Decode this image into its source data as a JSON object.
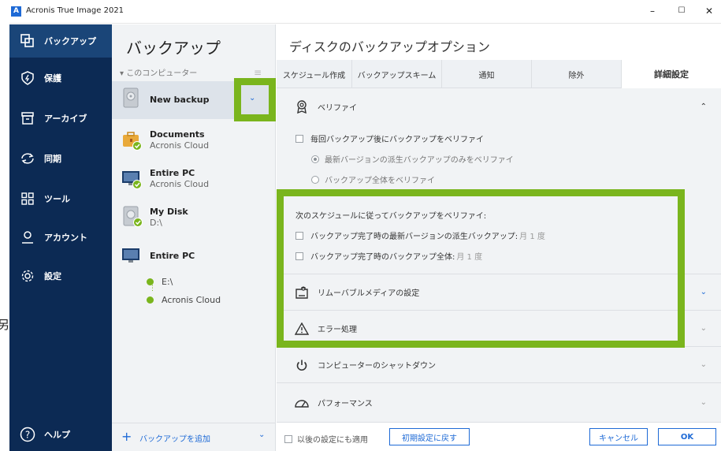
{
  "app": {
    "logo_letter": "A",
    "title": "Acronis True Image 2021"
  },
  "window_controls": {
    "minimize": "–",
    "maximize": "☐",
    "close": "✕"
  },
  "page_edge_glyph": "另",
  "nav": {
    "items": [
      {
        "label": "バックアップ",
        "icon": "backup-icon",
        "active": true
      },
      {
        "label": "保護",
        "icon": "shield-icon"
      },
      {
        "label": "アーカイブ",
        "icon": "archive-icon"
      },
      {
        "label": "同期",
        "icon": "sync-icon"
      },
      {
        "label": "ツール",
        "icon": "tools-grid-icon"
      },
      {
        "label": "アカウント",
        "icon": "user-icon"
      },
      {
        "label": "設定",
        "icon": "gear-icon"
      }
    ],
    "help": {
      "label": "ヘルプ",
      "icon": "help-icon"
    }
  },
  "backup_list": {
    "title": "バックアップ",
    "group_header": "このコンピューター",
    "items": [
      {
        "name": "New backup",
        "sub": ""
      },
      {
        "name": "Documents",
        "sub": "Acronis Cloud"
      },
      {
        "name": "Entire PC",
        "sub": "Acronis Cloud"
      },
      {
        "name": "My Disk",
        "sub": "D:\\"
      },
      {
        "name": "Entire PC",
        "sub": ""
      }
    ],
    "destinations": [
      "E:\\",
      "Acronis Cloud"
    ],
    "add_label": "バックアップを追加"
  },
  "main": {
    "title": "ディスクのバックアップオプション",
    "tabs": [
      "スケジュール作成",
      "バックアップスキーム",
      "通知",
      "除外",
      "詳細設定"
    ],
    "sections": {
      "verify": "ベリファイ",
      "removable": "リムーバブルメディアの設定",
      "error": "エラー処理",
      "shutdown": "コンピューターのシャットダウン",
      "performance": "パフォーマンス"
    },
    "options": {
      "verify_each": "毎回バックアップ後にバックアップをベリファイ",
      "latest_only": "最新バージョンの派生バックアップのみをベリファイ",
      "verify_all": "バックアップ全体をベリファイ",
      "schedule_heading": "次のスケジュールに従ってバックアップをベリファイ:",
      "sched_latest": "バックアップ完了時の最新バージョンの派生バックアップ:",
      "sched_latest_freq": "月 1 度",
      "sched_full": "バックアップ完了時のバックアップ全体:",
      "sched_full_freq": "月 1 度"
    },
    "footer": {
      "apply_later": "以後の設定にも適用",
      "reset": "初期設定に戻す",
      "cancel": "キャンセル",
      "ok": "OK"
    }
  },
  "colors": {
    "nav_bg": "#0c2a54",
    "accent": "#1e6ad6",
    "highlight": "#7ab51d",
    "panel_bg": "#f1f3f5"
  }
}
